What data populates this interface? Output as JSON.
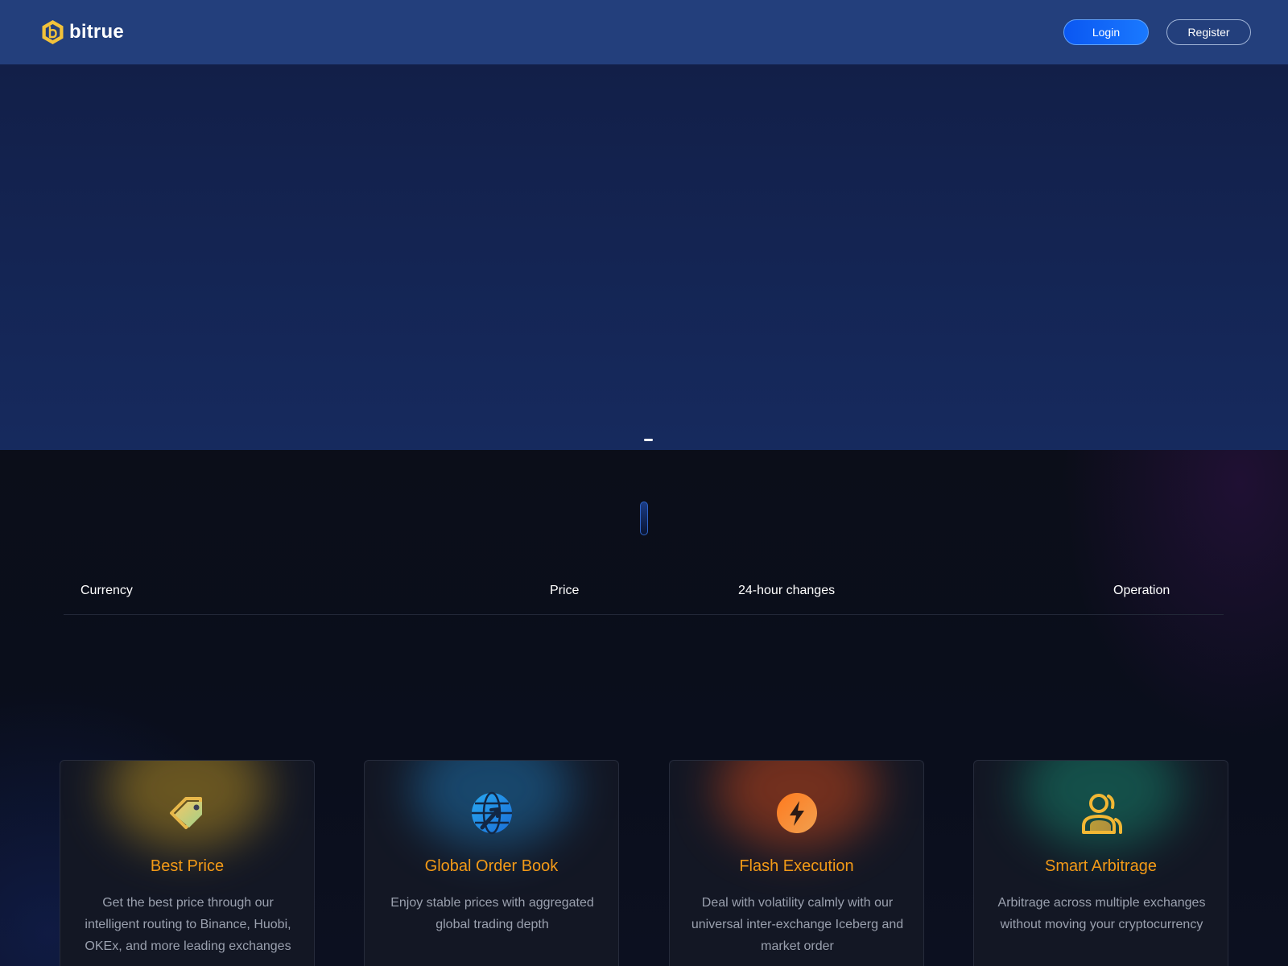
{
  "header": {
    "brand": "bitrue",
    "login_label": "Login",
    "register_label": "Register"
  },
  "market_table": {
    "columns": [
      "Currency",
      "Price",
      "24-hour changes",
      "Operation"
    ]
  },
  "features": [
    {
      "title": "Best Price",
      "description": "Get the best price through our intelligent routing to Binance, Huobi, OKEx, and more leading exchanges",
      "icon": "price-tag-icon",
      "glow": "#b08a20"
    },
    {
      "title": "Global Order Book",
      "description": "Enjoy stable prices with aggregated global trading depth",
      "icon": "globe-icon",
      "glow": "#1e6fa8"
    },
    {
      "title": "Flash Execution",
      "description": "Deal with volatility calmly with our universal inter-exchange Iceberg and market order",
      "icon": "lightning-icon",
      "glow": "#c2451a"
    },
    {
      "title": "Smart Arbitrage",
      "description": "Arbitrage across multiple exchanges without moving your cryptocurrency",
      "icon": "users-icon",
      "glow": "#16806a"
    }
  ],
  "colors": {
    "header_bg": "#233f7c",
    "accent_orange": "#f39a17",
    "login_blue": "#0a57f2"
  }
}
